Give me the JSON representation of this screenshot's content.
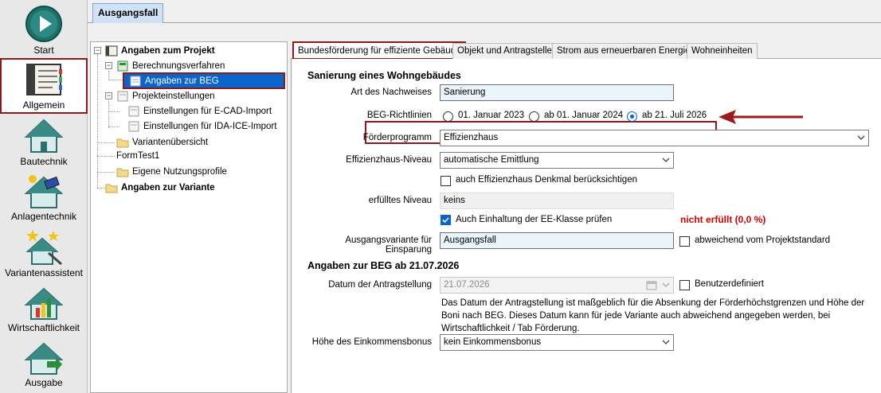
{
  "nav": [
    {
      "label": "Start",
      "icon": "play-icon"
    },
    {
      "label": "Allgemein",
      "icon": "binder-icon"
    },
    {
      "label": "Bautechnik",
      "icon": "house-icon"
    },
    {
      "label": "Anlagentechnik",
      "icon": "house-solar-icon"
    },
    {
      "label": "Variantenassistent",
      "icon": "wizard-icon"
    },
    {
      "label": "Wirtschaftlichkeit",
      "icon": "house-chart-icon"
    },
    {
      "label": "Ausgabe",
      "icon": "house-export-icon"
    }
  ],
  "doc_tab": "Ausgangsfall",
  "tree": {
    "root": "Angaben zum Projekt",
    "berechnung": "Berechnungsverfahren",
    "beg": "Angaben zur BEG",
    "projekteinst": "Projekteinstellungen",
    "ecad": "Einstellungen für E-CAD-Import",
    "ida": "Einstellungen für IDA-ICE-Import",
    "varianten": "Variantenübersicht",
    "formtest": "FormTest1",
    "nutzung": "Eigene Nutzungsprofile",
    "variante": "Angaben zur Variante"
  },
  "tabs": [
    "Bundesförderung für effiziente Gebäude",
    "Objekt und Antragsteller",
    "Strom aus erneuerbaren Energien",
    "Wohneinheiten"
  ],
  "form": {
    "section1": "Sanierung eines Wohngebäudes",
    "nachweis_label": "Art des Nachweises",
    "nachweis_value": "Sanierung",
    "richtlinien_label": "BEG-Richtlinien",
    "radio1": "01. Januar 2023",
    "radio2": "ab 01. Januar 2024",
    "radio3": "ab 21. Juli 2026",
    "foerder_label": "Förderprogramm",
    "foerder_value": "Effizienzhaus",
    "niveau_label": "Effizienzhaus-Niveau",
    "niveau_value": "automatische Emittlung",
    "denkmal_label": "auch Effizienzhaus Denkmal berücksichtigen",
    "erfuellt_label": "erfülltes Niveau",
    "erfuellt_value": "keins",
    "ee_label": "Auch Einhaltung der EE-Klasse prüfen",
    "ee_status": "nicht erfüllt (0,0 %)",
    "einsparung_label": "Ausgangsvariante für Einsparung",
    "einsparung_value": "Ausgangsfall",
    "abweichend_label": "abweichend vom Projektstandard",
    "section2": "Angaben zur BEG ab 21.07.2026",
    "datum_label": "Datum der Antragstellung",
    "datum_value": "21.07.2026",
    "benutzer_label": "Benutzerdefiniert",
    "info_text": "Das Datum der Antragstellung ist maßgeblich für die Absenkung der Förderhöchstgrenzen und Höhe der Boni nach BEG. Dieses Datum kann für jede Variante auch abweichend angegeben werden, bei Wirtschaftlichkeit / Tab Förderung.",
    "einkommen_label": "Höhe des Einkommensbonus",
    "einkommen_value": "kein Einkommensbonus"
  },
  "colors": {
    "highlight": "#8b1a1a",
    "selection": "#0a64c9",
    "status_red": "#d40000",
    "arrow": "#9b1b1b"
  }
}
